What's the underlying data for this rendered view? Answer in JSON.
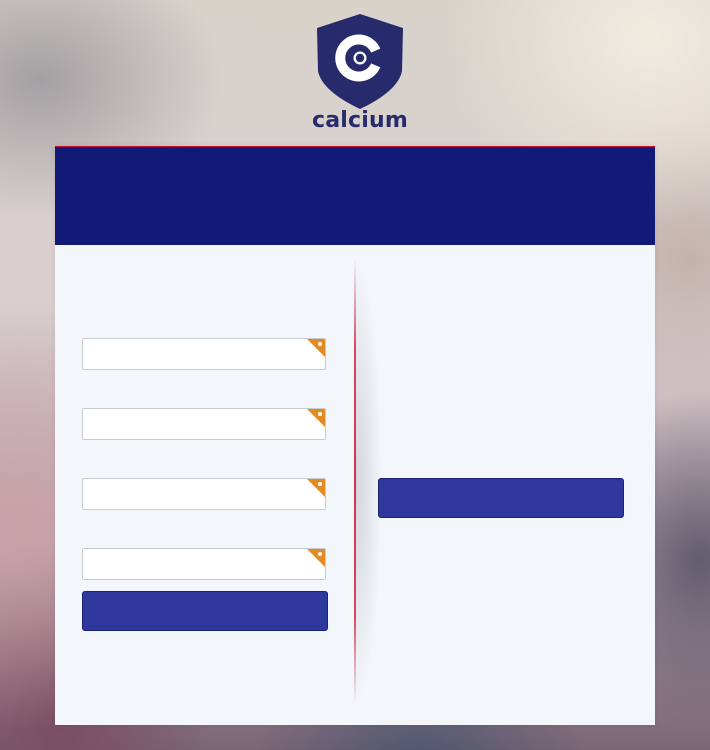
{
  "brand": {
    "name": "calcium",
    "logo_icon": "calcium-shield-logo",
    "colors": {
      "navy": "#282b6b",
      "header": "#121a78",
      "button": "#2f389c",
      "accent_line": "#c8102e",
      "required_marker": "#e48a22"
    }
  },
  "form": {
    "fields": [
      {
        "value": "",
        "placeholder": "",
        "required_icon": "required-corner-icon"
      },
      {
        "value": "",
        "placeholder": "",
        "required_icon": "required-corner-icon"
      },
      {
        "value": "",
        "placeholder": "",
        "required_icon": "required-corner-icon"
      },
      {
        "value": "",
        "placeholder": "",
        "required_icon": "required-corner-icon"
      }
    ],
    "submit_label": ""
  },
  "side": {
    "button_label": ""
  }
}
